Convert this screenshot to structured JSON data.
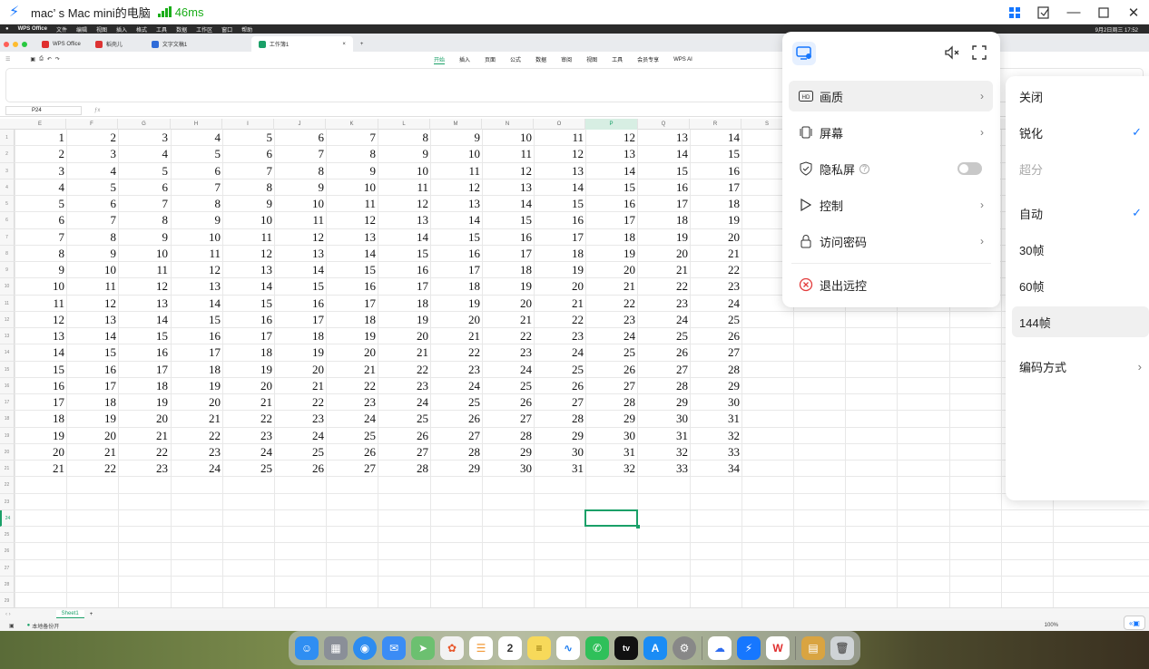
{
  "outer_bar": {
    "title": "mac’ s Mac mini的电脑",
    "latency": "46ms"
  },
  "mac_menubar": {
    "items": [
      "WPS Office",
      "文件",
      "编辑",
      "视图",
      "插入",
      "格式",
      "工具",
      "数据",
      "工作区",
      "窗口",
      "帮助"
    ],
    "clock": "9月2日周三 17:52"
  },
  "doc_tabs": [
    {
      "label": "WPS Office",
      "color": "#e02f2f"
    },
    {
      "label": "稻壳儿",
      "color": "#d33"
    },
    {
      "label": "文字文稿1",
      "color": "#2f6bd8"
    },
    {
      "label": "工作簿1",
      "color": "#1aa068"
    }
  ],
  "ribbon_tabs": [
    "开始",
    "插入",
    "页面",
    "公式",
    "数据",
    "审阅",
    "视图",
    "工具",
    "会员专享",
    "WPS AI"
  ],
  "name_box": "P24",
  "columns": [
    "E",
    "F",
    "G",
    "H",
    "I",
    "J",
    "K",
    "L",
    "M",
    "N",
    "O",
    "P",
    "Q",
    "R",
    "S"
  ],
  "rows": [
    [
      1,
      2,
      3,
      4,
      5,
      6,
      7,
      8,
      9,
      10,
      11,
      12,
      13,
      14
    ],
    [
      2,
      3,
      4,
      5,
      6,
      7,
      8,
      9,
      10,
      11,
      12,
      13,
      14,
      15
    ],
    [
      3,
      4,
      5,
      6,
      7,
      8,
      9,
      10,
      11,
      12,
      13,
      14,
      15,
      16
    ],
    [
      4,
      5,
      6,
      7,
      8,
      9,
      10,
      11,
      12,
      13,
      14,
      15,
      16,
      17
    ],
    [
      5,
      6,
      7,
      8,
      9,
      10,
      11,
      12,
      13,
      14,
      15,
      16,
      17,
      18
    ],
    [
      6,
      7,
      8,
      9,
      10,
      11,
      12,
      13,
      14,
      15,
      16,
      17,
      18,
      19
    ],
    [
      7,
      8,
      9,
      10,
      11,
      12,
      13,
      14,
      15,
      16,
      17,
      18,
      19,
      20
    ],
    [
      8,
      9,
      10,
      11,
      12,
      13,
      14,
      15,
      16,
      17,
      18,
      19,
      20,
      21
    ],
    [
      9,
      10,
      11,
      12,
      13,
      14,
      15,
      16,
      17,
      18,
      19,
      20,
      21,
      22
    ],
    [
      10,
      11,
      12,
      13,
      14,
      15,
      16,
      17,
      18,
      19,
      20,
      21,
      22,
      23
    ],
    [
      11,
      12,
      13,
      14,
      15,
      16,
      17,
      18,
      19,
      20,
      21,
      22,
      23,
      24
    ],
    [
      12,
      13,
      14,
      15,
      16,
      17,
      18,
      19,
      20,
      21,
      22,
      23,
      24,
      25
    ],
    [
      13,
      14,
      15,
      16,
      17,
      18,
      19,
      20,
      21,
      22,
      23,
      24,
      25,
      26
    ],
    [
      14,
      15,
      16,
      17,
      18,
      19,
      20,
      21,
      22,
      23,
      24,
      25,
      26,
      27
    ],
    [
      15,
      16,
      17,
      18,
      19,
      20,
      21,
      22,
      23,
      24,
      25,
      26,
      27,
      28
    ],
    [
      16,
      17,
      18,
      19,
      20,
      21,
      22,
      23,
      24,
      25,
      26,
      27,
      28,
      29
    ],
    [
      17,
      18,
      19,
      20,
      21,
      22,
      23,
      24,
      25,
      26,
      27,
      28,
      29,
      30
    ],
    [
      18,
      19,
      20,
      21,
      22,
      23,
      24,
      25,
      26,
      27,
      28,
      29,
      30,
      31
    ],
    [
      19,
      20,
      21,
      22,
      23,
      24,
      25,
      26,
      27,
      28,
      29,
      30,
      31,
      32
    ],
    [
      20,
      21,
      22,
      23,
      24,
      25,
      26,
      27,
      28,
      29,
      30,
      31,
      32,
      33
    ],
    [
      21,
      22,
      23,
      24,
      25,
      26,
      27,
      28,
      29,
      30,
      31,
      32,
      33,
      34
    ]
  ],
  "sheet_tab": "Sheet1",
  "status": {
    "backup": "本地备份开",
    "zoom": "100%"
  },
  "control_panel": {
    "items": [
      {
        "label": "画质",
        "icon": "hd-icon",
        "chevron": "›"
      },
      {
        "label": "屏幕",
        "icon": "screen-icon",
        "chevron": "›"
      },
      {
        "label": "隐私屏",
        "icon": "shield-icon"
      },
      {
        "label": "控制",
        "icon": "cursor-icon",
        "chevron": "›"
      },
      {
        "label": "访问密码",
        "icon": "lock-icon",
        "chevron": "›"
      }
    ],
    "exit_label": "退出远控"
  },
  "quality_menu": {
    "items": [
      {
        "label": "关闭"
      },
      {
        "label": "锐化",
        "check": "✓"
      },
      {
        "label": "超分"
      },
      {
        "label": "自动",
        "check": "✓"
      },
      {
        "label": "30帧"
      },
      {
        "label": "60帧"
      },
      {
        "label": "144帧"
      },
      {
        "label": "编码方式",
        "chevron": "›"
      }
    ]
  },
  "dock": [
    "finder",
    "launchpad",
    "safari",
    "mail",
    "maps",
    "photos",
    "reminders",
    "calendar",
    "notes",
    "freeform",
    "wechat",
    "appletv",
    "appstore",
    "settings",
    "baidunetdisk",
    "todesk",
    "wps",
    "archive",
    "trash"
  ],
  "calendar_day": "2"
}
